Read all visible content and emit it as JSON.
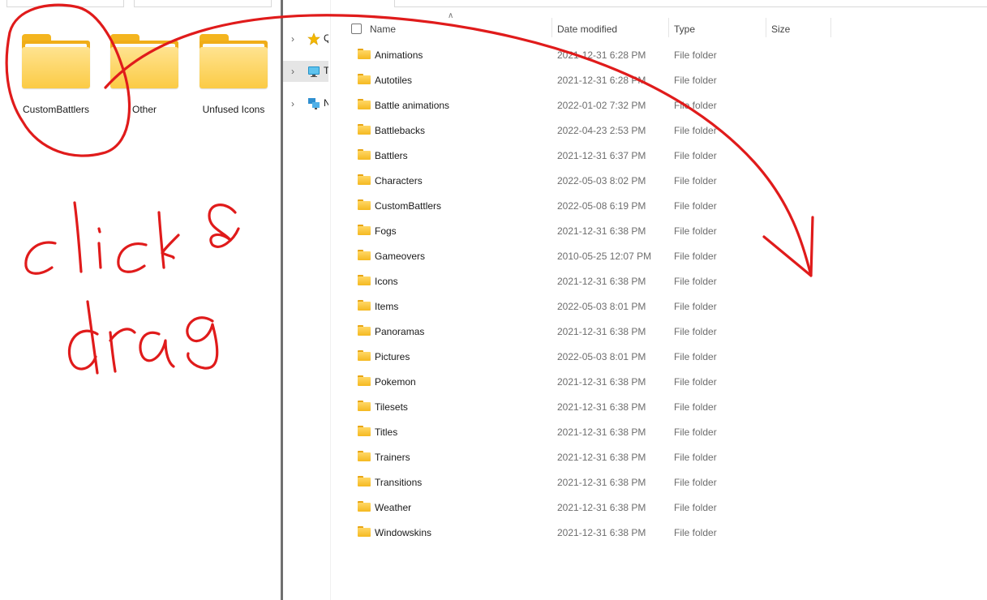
{
  "left_pane": {
    "items": [
      {
        "label": "CustomBattlers",
        "icon": "folder-icon"
      },
      {
        "label": "Other",
        "icon": "folder-icon"
      },
      {
        "label": "Unfused Icons",
        "icon": "folder-icon"
      }
    ]
  },
  "nav_pane": {
    "items": [
      {
        "label": "Q",
        "icon": "star-icon",
        "selected": false
      },
      {
        "label": "T",
        "icon": "monitor-icon",
        "selected": true
      },
      {
        "label": "N",
        "icon": "network-icon",
        "selected": false
      }
    ]
  },
  "details": {
    "columns": {
      "name": "Name",
      "date": "Date modified",
      "type": "Type",
      "size": "Size"
    },
    "sorted_column": "name",
    "rows": [
      {
        "name": "Animations",
        "date": "2021-12-31 6:28 PM",
        "type": "File folder"
      },
      {
        "name": "Autotiles",
        "date": "2021-12-31 6:28 PM",
        "type": "File folder"
      },
      {
        "name": "Battle animations",
        "date": "2022-01-02 7:32 PM",
        "type": "File folder"
      },
      {
        "name": "Battlebacks",
        "date": "2022-04-23 2:53 PM",
        "type": "File folder"
      },
      {
        "name": "Battlers",
        "date": "2021-12-31 6:37 PM",
        "type": "File folder"
      },
      {
        "name": "Characters",
        "date": "2022-05-03 8:02 PM",
        "type": "File folder"
      },
      {
        "name": "CustomBattlers",
        "date": "2022-05-08 6:19 PM",
        "type": "File folder"
      },
      {
        "name": "Fogs",
        "date": "2021-12-31 6:38 PM",
        "type": "File folder"
      },
      {
        "name": "Gameovers",
        "date": "2010-05-25 12:07 PM",
        "type": "File folder"
      },
      {
        "name": "Icons",
        "date": "2021-12-31 6:38 PM",
        "type": "File folder"
      },
      {
        "name": "Items",
        "date": "2022-05-03 8:01 PM",
        "type": "File folder"
      },
      {
        "name": "Panoramas",
        "date": "2021-12-31 6:38 PM",
        "type": "File folder"
      },
      {
        "name": "Pictures",
        "date": "2022-05-03 8:01 PM",
        "type": "File folder"
      },
      {
        "name": "Pokemon",
        "date": "2021-12-31 6:38 PM",
        "type": "File folder"
      },
      {
        "name": "Tilesets",
        "date": "2021-12-31 6:38 PM",
        "type": "File folder"
      },
      {
        "name": "Titles",
        "date": "2021-12-31 6:38 PM",
        "type": "File folder"
      },
      {
        "name": "Trainers",
        "date": "2021-12-31 6:38 PM",
        "type": "File folder"
      },
      {
        "name": "Transitions",
        "date": "2021-12-31 6:38 PM",
        "type": "File folder"
      },
      {
        "name": "Weather",
        "date": "2021-12-31 6:38 PM",
        "type": "File folder"
      },
      {
        "name": "Windowskins",
        "date": "2021-12-31 6:38 PM",
        "type": "File folder"
      }
    ]
  },
  "annotation": {
    "line1": "click &",
    "line2": "drag",
    "color": "#e01b1b"
  }
}
